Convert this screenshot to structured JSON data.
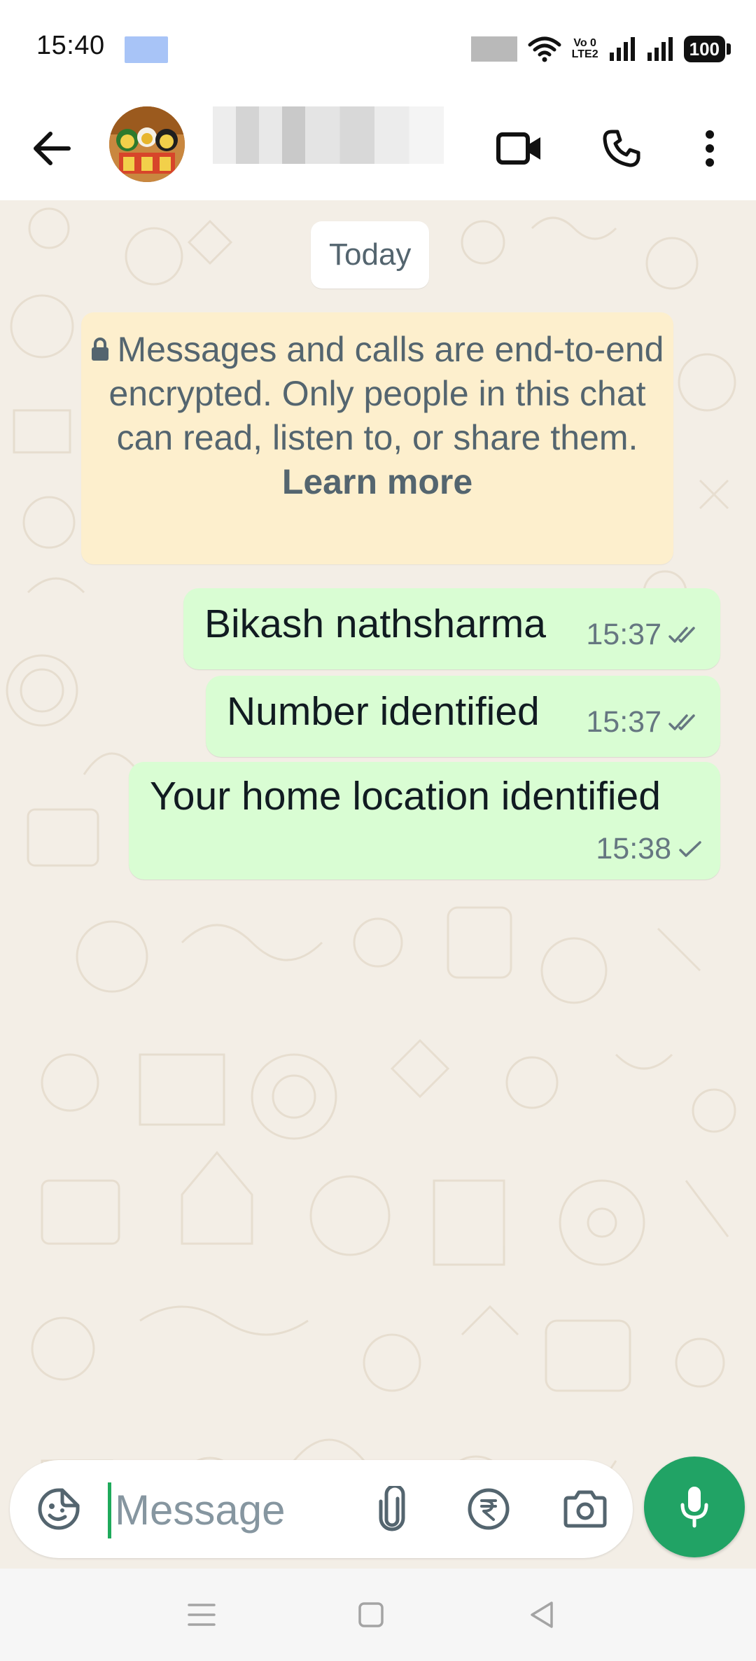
{
  "status_bar": {
    "time": "15:40",
    "volte_label": "Vo LTE2",
    "battery": "100",
    "icons": [
      "notification-thumbnail",
      "blurred-icon",
      "wifi-icon",
      "volte-icon",
      "signal-icon",
      "signal-icon",
      "battery-icon"
    ]
  },
  "header": {
    "back_icon": "arrow-left-icon",
    "avatar": "contact-avatar",
    "contact_name_blurred": true,
    "video_call_icon": "video-camera-icon",
    "voice_call_icon": "phone-icon",
    "menu_icon": "more-vertical-icon"
  },
  "chat": {
    "date_label": "Today",
    "encryption_notice": {
      "icon": "lock-icon",
      "text": "Messages and calls are end-to-end encrypted. Only people in this chat can read, listen to, or share them.",
      "link": "Learn more",
      "colors": {
        "background": "#fdefcd",
        "text": "#54656f"
      }
    },
    "messages": [
      {
        "text": "Bikash nathsharma",
        "time": "15:37",
        "status": "read",
        "status_icon": "double-check-icon"
      },
      {
        "text": "Number identified",
        "time": "15:37",
        "status": "read",
        "status_icon": "double-check-icon"
      },
      {
        "text": "Your home location identified",
        "time": "15:38",
        "status": "sent",
        "status_icon": "single-check-icon"
      }
    ],
    "colors": {
      "outgoing_bubble": "#d9fdd3",
      "wallpaper": "#f3eee6"
    }
  },
  "composer": {
    "placeholder": "Message",
    "value": "",
    "sticker_icon": "sticker-icon",
    "attach_icon": "paperclip-icon",
    "payment_icon": "rupee-icon",
    "camera_icon": "camera-icon",
    "mic_icon": "mic-icon",
    "colors": {
      "mic_button": "#21a365",
      "cursor": "#1faa5b"
    }
  },
  "nav_bar": {
    "icons": [
      "menu-icon",
      "home-square-icon",
      "back-triangle-icon"
    ]
  }
}
